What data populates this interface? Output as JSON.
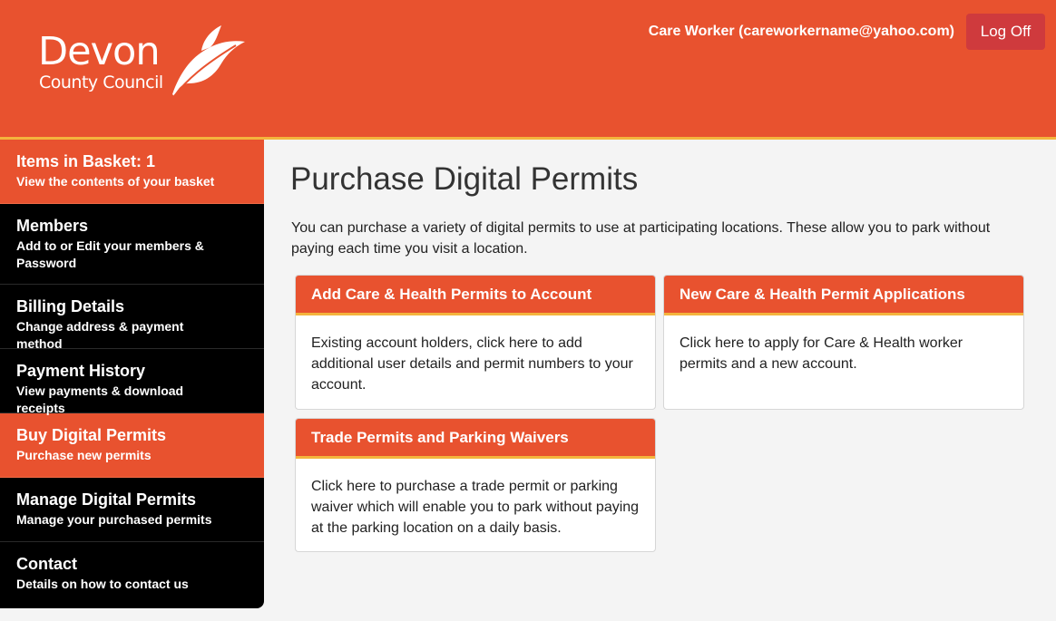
{
  "header": {
    "logo_line1": "Devon",
    "logo_line2": "County Council",
    "user": "Care Worker (careworkername@yahoo.com)",
    "logoff_label": "Log Off",
    "colors": {
      "brand": "#e8522f",
      "accent_rule": "#f4b43d",
      "logoff": "#cf3a3d"
    }
  },
  "sidebar": {
    "items": [
      {
        "title": "Items in Basket: 1",
        "subtitle": "View the contents of your basket",
        "highlighted": true
      },
      {
        "title": "Members",
        "subtitle": "Add to or Edit your members & Password",
        "highlighted": false
      },
      {
        "title": "Billing Details",
        "subtitle": "Change address & payment method",
        "highlighted": false
      },
      {
        "title": "Payment History",
        "subtitle": "View payments & download receipts",
        "highlighted": false
      },
      {
        "title": "Buy Digital Permits",
        "subtitle": "Purchase new permits",
        "highlighted": true
      },
      {
        "title": "Manage Digital Permits",
        "subtitle": "Manage your purchased permits",
        "highlighted": false
      },
      {
        "title": "Contact",
        "subtitle": "Details on how to contact us",
        "highlighted": false
      }
    ]
  },
  "main": {
    "title": "Purchase Digital Permits",
    "intro": "You can purchase a variety of digital permits to use at participating locations. These allow you to park without paying each time you visit a location.",
    "cards": [
      {
        "title": "Add Care & Health Permits to Account",
        "body": "Existing account holders, click here to add additional user details and permit numbers to your account."
      },
      {
        "title": "New Care & Health Permit Applications",
        "body": "Click here to apply for Care & Health worker permits and a new account."
      },
      {
        "title": "Trade Permits and Parking Waivers",
        "body": "Click here to purchase a trade permit or parking waiver which will enable you to park without paying at the parking location on a daily basis."
      }
    ]
  },
  "icons": {
    "logo_leaf": "leaf-icon"
  }
}
